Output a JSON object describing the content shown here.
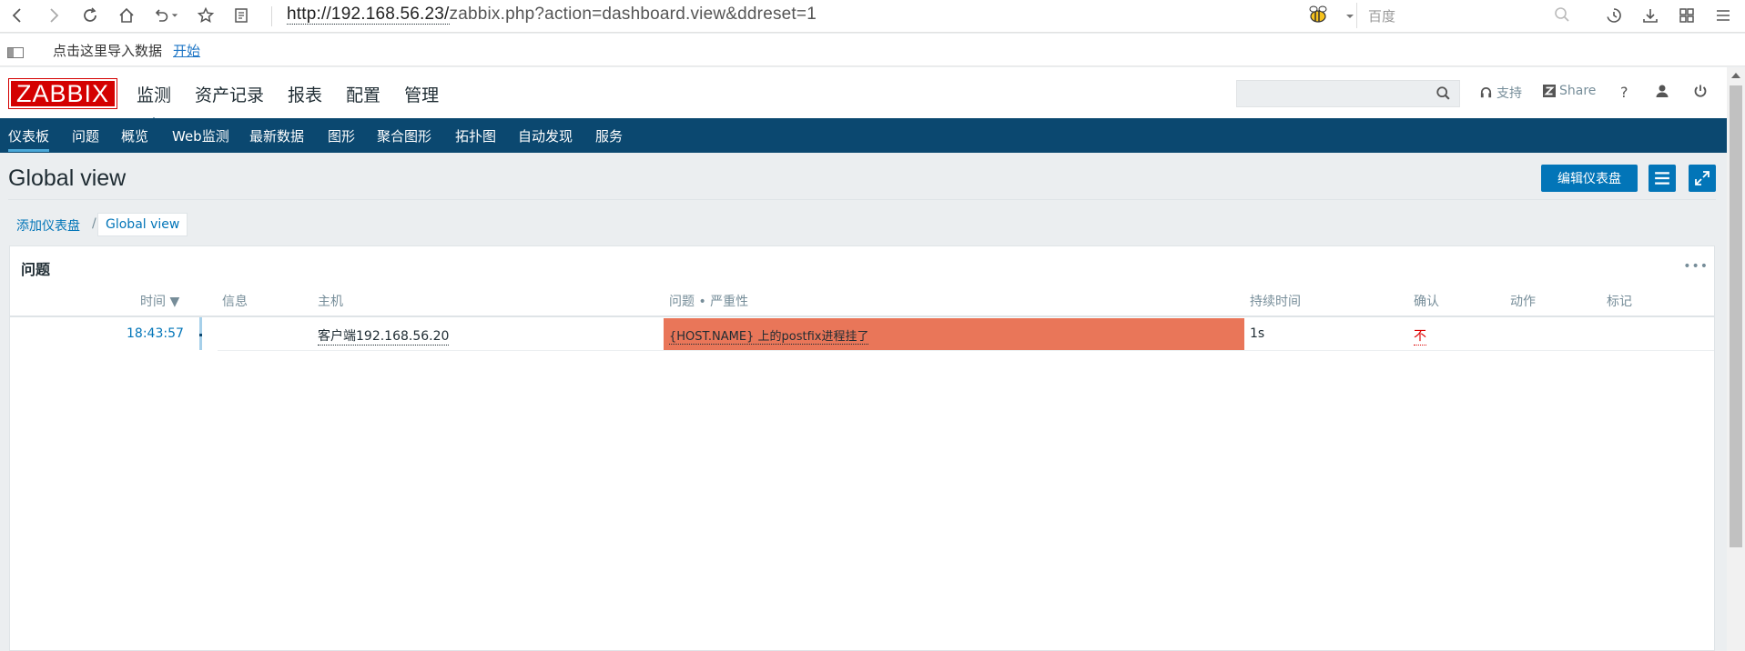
{
  "browser": {
    "url_host": "http://192.168.56.23/",
    "url_rest": "zabbix.php?action=dashboard.view&ddreset=1",
    "search_placeholder": "百度",
    "bookmark_text": "点击这里导入数据",
    "bookmark_link": "开始"
  },
  "header": {
    "logo": "ZABBIX",
    "menu": [
      "监测",
      "资产记录",
      "报表",
      "配置",
      "管理"
    ],
    "support": "支持",
    "share": "Share",
    "help": "?"
  },
  "subnav": [
    "仪表板",
    "问题",
    "概览",
    "Web监测",
    "最新数据",
    "图形",
    "聚合图形",
    "拓扑图",
    "自动发现",
    "服务"
  ],
  "page": {
    "title": "Global view",
    "edit_button": "编辑仪表盘",
    "breadcrumb_link": "添加仪表盘",
    "breadcrumb_sep": "/",
    "breadcrumb_current": "Global view"
  },
  "widget": {
    "title": "问题",
    "menu": "•••",
    "columns": {
      "time": "时间 ▼",
      "info": "信息",
      "host": "主机",
      "problem": "问题 • 严重性",
      "duration": "持续时间",
      "ack": "确认",
      "actions": "动作",
      "tags": "标记"
    },
    "rows": [
      {
        "time": "18:43:57",
        "host": "客户端192.168.56.20",
        "problem": "{HOST.NAME} 上的postfix进程挂了",
        "duration": "1s",
        "ack": "不"
      }
    ],
    "severity_color": "#e97659"
  }
}
